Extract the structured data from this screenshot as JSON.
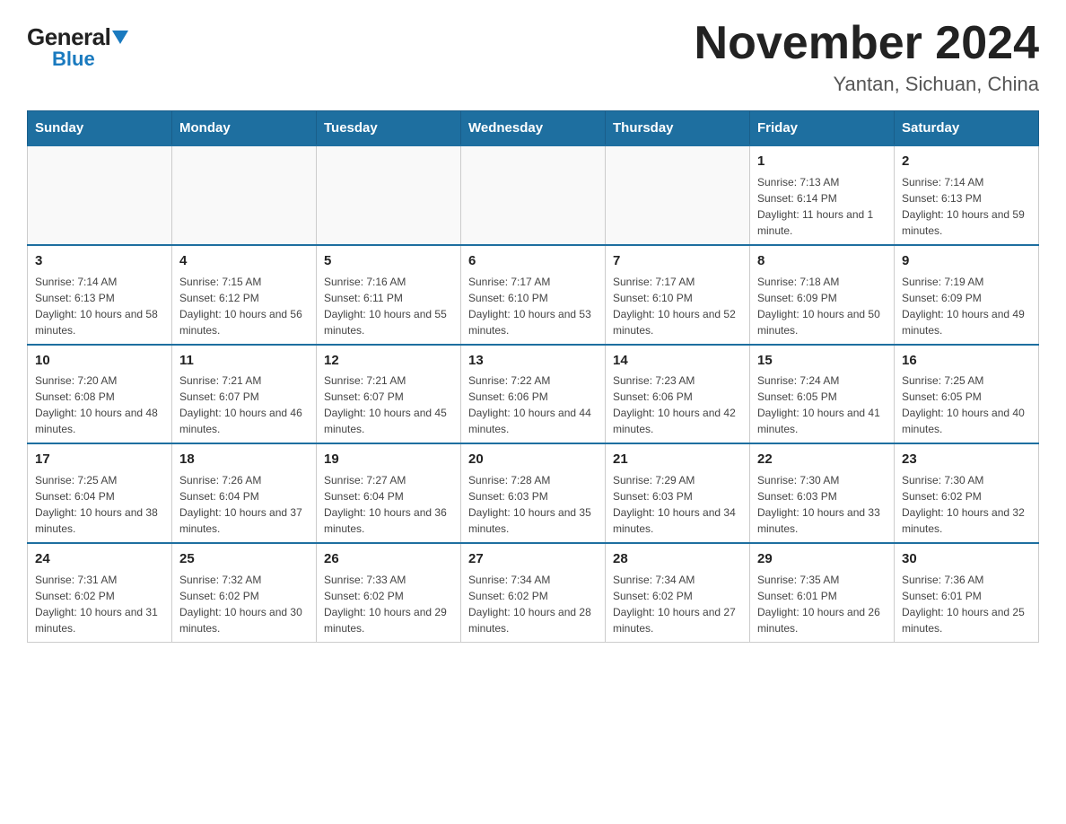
{
  "logo": {
    "general": "General",
    "blue": "Blue",
    "triangle": "▼"
  },
  "title": "November 2024",
  "subtitle": "Yantan, Sichuan, China",
  "weekdays": [
    "Sunday",
    "Monday",
    "Tuesday",
    "Wednesday",
    "Thursday",
    "Friday",
    "Saturday"
  ],
  "weeks": [
    [
      {
        "day": "",
        "info": ""
      },
      {
        "day": "",
        "info": ""
      },
      {
        "day": "",
        "info": ""
      },
      {
        "day": "",
        "info": ""
      },
      {
        "day": "",
        "info": ""
      },
      {
        "day": "1",
        "info": "Sunrise: 7:13 AM\nSunset: 6:14 PM\nDaylight: 11 hours and 1 minute."
      },
      {
        "day": "2",
        "info": "Sunrise: 7:14 AM\nSunset: 6:13 PM\nDaylight: 10 hours and 59 minutes."
      }
    ],
    [
      {
        "day": "3",
        "info": "Sunrise: 7:14 AM\nSunset: 6:13 PM\nDaylight: 10 hours and 58 minutes."
      },
      {
        "day": "4",
        "info": "Sunrise: 7:15 AM\nSunset: 6:12 PM\nDaylight: 10 hours and 56 minutes."
      },
      {
        "day": "5",
        "info": "Sunrise: 7:16 AM\nSunset: 6:11 PM\nDaylight: 10 hours and 55 minutes."
      },
      {
        "day": "6",
        "info": "Sunrise: 7:17 AM\nSunset: 6:10 PM\nDaylight: 10 hours and 53 minutes."
      },
      {
        "day": "7",
        "info": "Sunrise: 7:17 AM\nSunset: 6:10 PM\nDaylight: 10 hours and 52 minutes."
      },
      {
        "day": "8",
        "info": "Sunrise: 7:18 AM\nSunset: 6:09 PM\nDaylight: 10 hours and 50 minutes."
      },
      {
        "day": "9",
        "info": "Sunrise: 7:19 AM\nSunset: 6:09 PM\nDaylight: 10 hours and 49 minutes."
      }
    ],
    [
      {
        "day": "10",
        "info": "Sunrise: 7:20 AM\nSunset: 6:08 PM\nDaylight: 10 hours and 48 minutes."
      },
      {
        "day": "11",
        "info": "Sunrise: 7:21 AM\nSunset: 6:07 PM\nDaylight: 10 hours and 46 minutes."
      },
      {
        "day": "12",
        "info": "Sunrise: 7:21 AM\nSunset: 6:07 PM\nDaylight: 10 hours and 45 minutes."
      },
      {
        "day": "13",
        "info": "Sunrise: 7:22 AM\nSunset: 6:06 PM\nDaylight: 10 hours and 44 minutes."
      },
      {
        "day": "14",
        "info": "Sunrise: 7:23 AM\nSunset: 6:06 PM\nDaylight: 10 hours and 42 minutes."
      },
      {
        "day": "15",
        "info": "Sunrise: 7:24 AM\nSunset: 6:05 PM\nDaylight: 10 hours and 41 minutes."
      },
      {
        "day": "16",
        "info": "Sunrise: 7:25 AM\nSunset: 6:05 PM\nDaylight: 10 hours and 40 minutes."
      }
    ],
    [
      {
        "day": "17",
        "info": "Sunrise: 7:25 AM\nSunset: 6:04 PM\nDaylight: 10 hours and 38 minutes."
      },
      {
        "day": "18",
        "info": "Sunrise: 7:26 AM\nSunset: 6:04 PM\nDaylight: 10 hours and 37 minutes."
      },
      {
        "day": "19",
        "info": "Sunrise: 7:27 AM\nSunset: 6:04 PM\nDaylight: 10 hours and 36 minutes."
      },
      {
        "day": "20",
        "info": "Sunrise: 7:28 AM\nSunset: 6:03 PM\nDaylight: 10 hours and 35 minutes."
      },
      {
        "day": "21",
        "info": "Sunrise: 7:29 AM\nSunset: 6:03 PM\nDaylight: 10 hours and 34 minutes."
      },
      {
        "day": "22",
        "info": "Sunrise: 7:30 AM\nSunset: 6:03 PM\nDaylight: 10 hours and 33 minutes."
      },
      {
        "day": "23",
        "info": "Sunrise: 7:30 AM\nSunset: 6:02 PM\nDaylight: 10 hours and 32 minutes."
      }
    ],
    [
      {
        "day": "24",
        "info": "Sunrise: 7:31 AM\nSunset: 6:02 PM\nDaylight: 10 hours and 31 minutes."
      },
      {
        "day": "25",
        "info": "Sunrise: 7:32 AM\nSunset: 6:02 PM\nDaylight: 10 hours and 30 minutes."
      },
      {
        "day": "26",
        "info": "Sunrise: 7:33 AM\nSunset: 6:02 PM\nDaylight: 10 hours and 29 minutes."
      },
      {
        "day": "27",
        "info": "Sunrise: 7:34 AM\nSunset: 6:02 PM\nDaylight: 10 hours and 28 minutes."
      },
      {
        "day": "28",
        "info": "Sunrise: 7:34 AM\nSunset: 6:02 PM\nDaylight: 10 hours and 27 minutes."
      },
      {
        "day": "29",
        "info": "Sunrise: 7:35 AM\nSunset: 6:01 PM\nDaylight: 10 hours and 26 minutes."
      },
      {
        "day": "30",
        "info": "Sunrise: 7:36 AM\nSunset: 6:01 PM\nDaylight: 10 hours and 25 minutes."
      }
    ]
  ]
}
